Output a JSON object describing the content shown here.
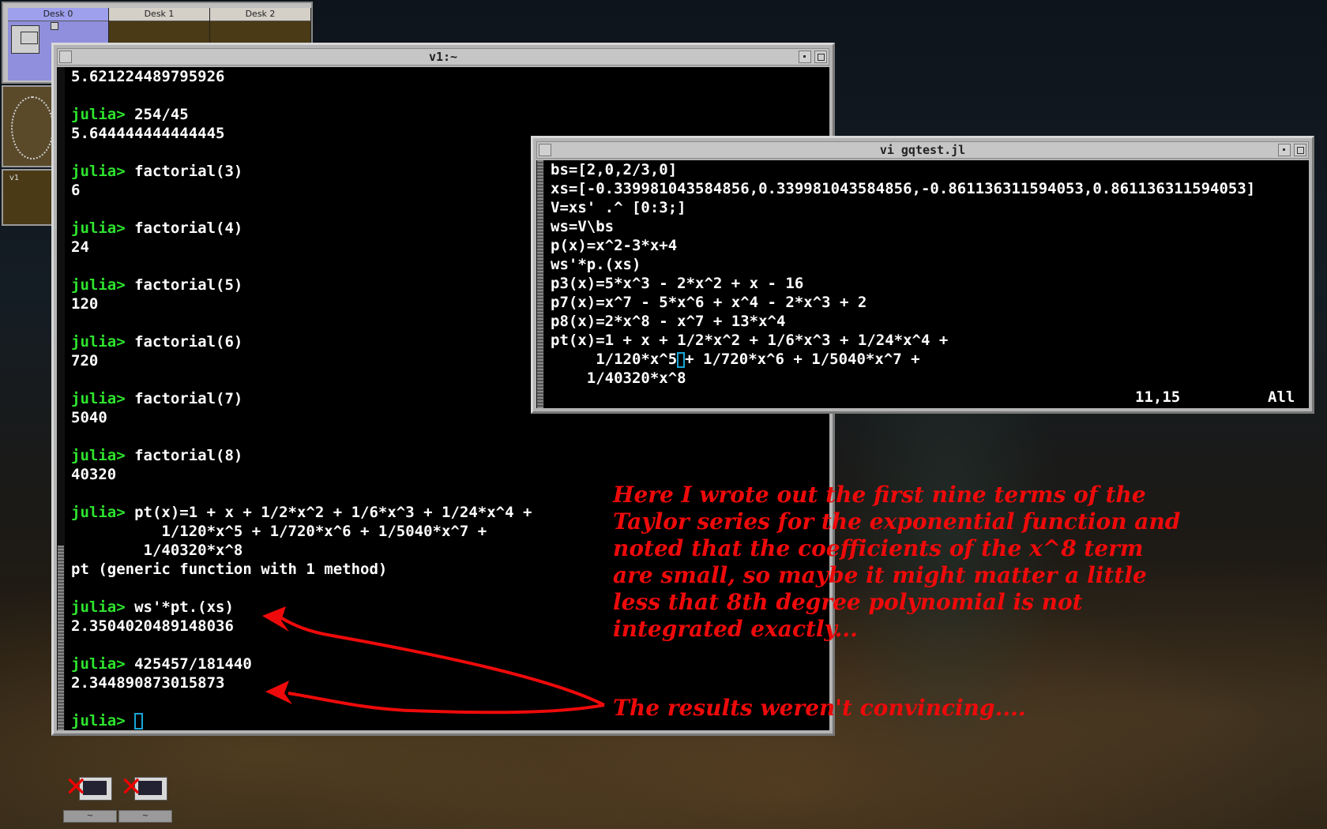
{
  "pager": {
    "desks": [
      "Desk 0",
      "Desk 1",
      "Desk 2"
    ],
    "mini_label": "v1"
  },
  "julia_window": {
    "title": "v1:~",
    "lines": [
      {
        "t": "out",
        "text": "5.621224489795926"
      },
      {
        "t": "blank",
        "text": ""
      },
      {
        "t": "in",
        "prompt": "julia> ",
        "text": "254/45"
      },
      {
        "t": "out",
        "text": "5.644444444444445"
      },
      {
        "t": "blank",
        "text": ""
      },
      {
        "t": "in",
        "prompt": "julia> ",
        "text": "factorial(3)"
      },
      {
        "t": "out",
        "text": "6"
      },
      {
        "t": "blank",
        "text": ""
      },
      {
        "t": "in",
        "prompt": "julia> ",
        "text": "factorial(4)"
      },
      {
        "t": "out",
        "text": "24"
      },
      {
        "t": "blank",
        "text": ""
      },
      {
        "t": "in",
        "prompt": "julia> ",
        "text": "factorial(5)"
      },
      {
        "t": "out",
        "text": "120"
      },
      {
        "t": "blank",
        "text": ""
      },
      {
        "t": "in",
        "prompt": "julia> ",
        "text": "factorial(6)"
      },
      {
        "t": "out",
        "text": "720"
      },
      {
        "t": "blank",
        "text": ""
      },
      {
        "t": "in",
        "prompt": "julia> ",
        "text": "factorial(7)"
      },
      {
        "t": "out",
        "text": "5040"
      },
      {
        "t": "blank",
        "text": ""
      },
      {
        "t": "in",
        "prompt": "julia> ",
        "text": "factorial(8)"
      },
      {
        "t": "out",
        "text": "40320"
      },
      {
        "t": "blank",
        "text": ""
      },
      {
        "t": "in",
        "prompt": "julia> ",
        "text": "pt(x)=1 + x + 1/2*x^2 + 1/6*x^3 + 1/24*x^4 +"
      },
      {
        "t": "out",
        "text": "          1/120*x^5 + 1/720*x^6 + 1/5040*x^7 +"
      },
      {
        "t": "out",
        "text": "        1/40320*x^8"
      },
      {
        "t": "out",
        "text": "pt (generic function with 1 method)"
      },
      {
        "t": "blank",
        "text": ""
      },
      {
        "t": "in",
        "prompt": "julia> ",
        "text": "ws'*pt.(xs)"
      },
      {
        "t": "out",
        "text": "2.3504020489148036"
      },
      {
        "t": "blank",
        "text": ""
      },
      {
        "t": "in",
        "prompt": "julia> ",
        "text": "425457/181440"
      },
      {
        "t": "out",
        "text": "2.344890873015873"
      },
      {
        "t": "blank",
        "text": ""
      },
      {
        "t": "cursor",
        "prompt": "julia> ",
        "text": ""
      }
    ]
  },
  "vi_window": {
    "title": "vi gqtest.jl",
    "lines": [
      "bs=[2,0,2/3,0]",
      "xs=[-0.339981043584856,0.339981043584856,-0.861136311594053,0.861136311594053]",
      "V=xs' .^ [0:3;]",
      "ws=V\\bs",
      "p(x)=x^2-3*x+4",
      "ws'*p.(xs)",
      "p3(x)=5*x^3 - 2*x^2 + x - 16",
      "p7(x)=x^7 - 5*x^6 + x^4 - 2*x^3 + 2",
      "p8(x)=2*x^8 - x^7 + 13*x^4",
      "pt(x)=1 + x + 1/2*x^2 + 1/6*x^3 + 1/24*x^4 +"
    ],
    "cursor_line_before": "     1/120*x^5",
    "cursor_line_after": "+ 1/720*x^6 + 1/5040*x^7 +",
    "last_line": "    1/40320*x^8",
    "status_pos": "11,15",
    "status_all": "All"
  },
  "annotations": {
    "note1": "Here I wrote out the first nine terms of the\nTaylor series for the exponential function and\nnoted that the coefficients of the x^8 term\nare small, so maybe it might matter a little\nless that 8th degree polynomial is not\nintegrated exactly...",
    "note2": "The results weren't convincing....",
    "color": "#ee0a0a"
  },
  "desktop_icons": [
    {
      "label": "~"
    },
    {
      "label": "~"
    }
  ]
}
